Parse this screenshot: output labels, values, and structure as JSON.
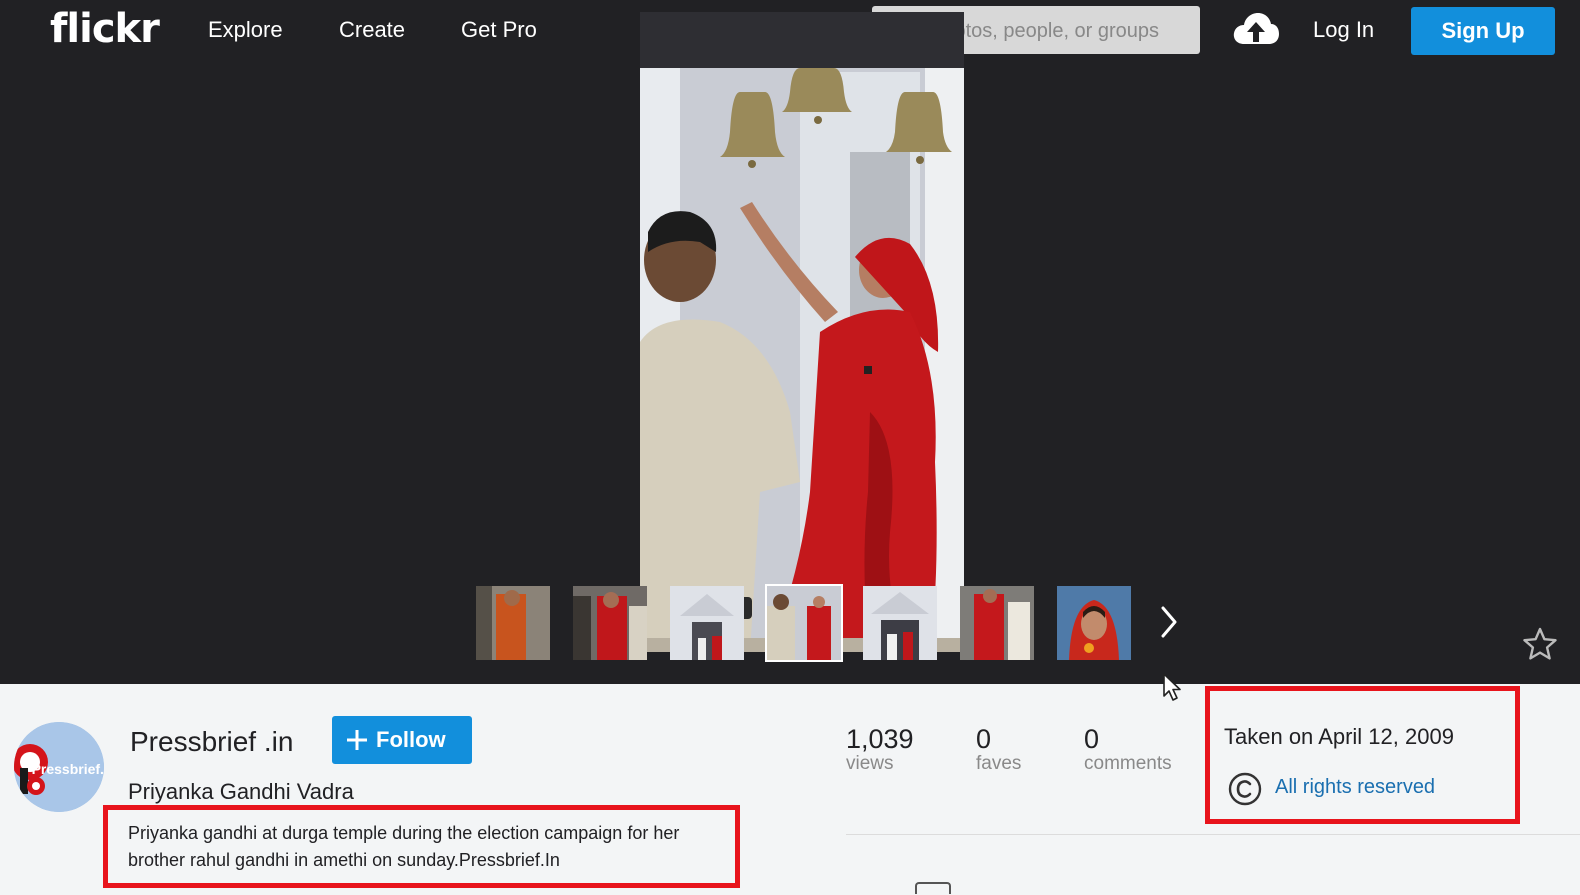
{
  "header": {
    "logo": "flickr",
    "nav": [
      "Explore",
      "Create",
      "Get Pro"
    ],
    "search_placeholder": "Photos, people, or groups",
    "login_label": "Log In",
    "signup_label": "Sign Up"
  },
  "owner": {
    "name": "Pressbrief .in",
    "follow_label": "Follow",
    "avatar_text": "Pressbrief.In"
  },
  "photo": {
    "title": "Priyanka Gandhi Vadra",
    "description": "Priyanka gandhi at durga temple during the election campaign for her brother rahul gandhi in amethi on sunday.Pressbrief.In"
  },
  "stats": [
    {
      "value": "1,039",
      "label": "views"
    },
    {
      "value": "0",
      "label": "faves"
    },
    {
      "value": "0",
      "label": "comments"
    }
  ],
  "meta": {
    "taken": "Taken on April 12, 2009",
    "license": "All rights reserved"
  },
  "colors": {
    "header_bg": "#212124",
    "accent_blue": "#128fdc",
    "highlight_red": "#e8141c",
    "link_blue": "#1a6fb0"
  },
  "thumbnails": {
    "count": 7,
    "active_index": 3
  },
  "icons": [
    "search-icon",
    "upload-cloud-icon",
    "plus-icon",
    "chevron-right-icon",
    "star-icon",
    "copyright-icon",
    "mouse-cursor-icon"
  ]
}
